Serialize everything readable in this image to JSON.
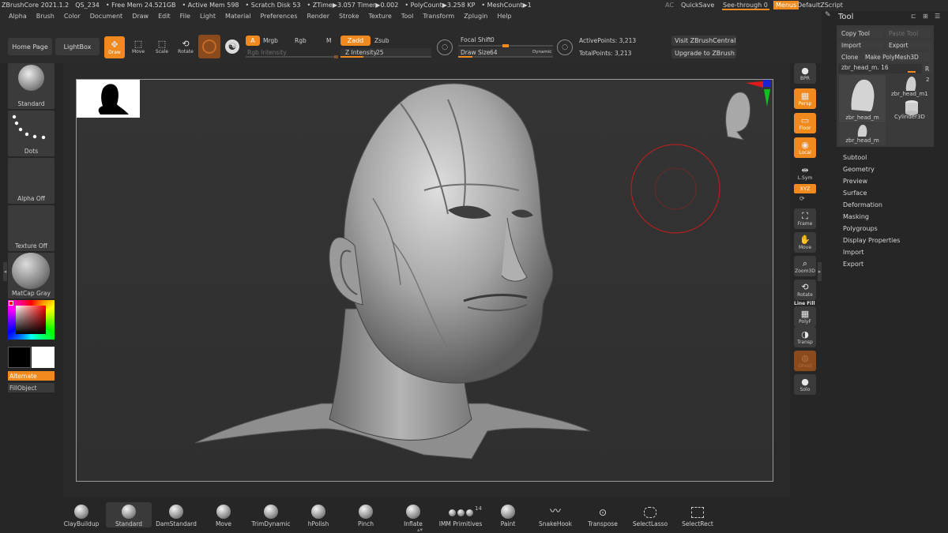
{
  "info": {
    "app": "ZBrushCore 2021.1.2",
    "file": "QS_234",
    "free_mem": "• Free Mem 24.521GB",
    "active_mem": "• Active Mem 598",
    "scratch": "• Scratch Disk 53",
    "ztime": "• ZTime▶3.057 Timer▶0.002",
    "polycount": "• PolyCount▶3.258 KP",
    "meshcount": "• MeshCount▶1"
  },
  "menus": [
    "Alpha",
    "Brush",
    "Color",
    "Document",
    "Draw",
    "Edit",
    "File",
    "Light",
    "Material",
    "Preferences",
    "Render",
    "Stroke",
    "Texture",
    "Tool",
    "Transform",
    "Zplugin",
    "Help"
  ],
  "topright": {
    "ac": "AC",
    "quicksave": "QuickSave",
    "seethrough": "See-through  0",
    "menus": "Menus",
    "script": "DefaultZScript"
  },
  "toolbar": {
    "home": "Home Page",
    "lightbox": "LightBox",
    "draw": "Draw",
    "move": "Move",
    "scale": "Scale",
    "rotate": "Rotate",
    "a": "A",
    "mrgb": "Mrgb",
    "rgb": "Rgb",
    "m": "M",
    "zadd": "Zadd",
    "zsub": "Zsub",
    "rgb_intensity": "Rgb Intensity",
    "z_intensity_label": "Z Intensity",
    "z_intensity_value": "25",
    "z_intensity_fraction": 0.25,
    "focal_shift_label": "Focal Shift",
    "focal_shift_value": "0",
    "draw_size_label": "Draw Size",
    "draw_size_value": "64",
    "dynamic": "Dynamic",
    "active_points": "ActivePoints: 3,213",
    "total_points": "TotalPoints: 3,213",
    "visit": "Visit ZBrushCentral",
    "upgrade": "Upgrade to ZBrush"
  },
  "leftshelf": {
    "brush": "Standard",
    "stroke": "Dots",
    "alpha": "Alpha Off",
    "texture": "Texture Off",
    "material": "MatCap Gray",
    "alternate": "Alternate",
    "fillobject": "FillObject"
  },
  "rightshelf": [
    "BPR",
    "Persp",
    "Floor",
    "Local",
    "L.Sym",
    "XYZ",
    "Frame",
    "Move",
    "Zoom3D",
    "Rotate",
    "PolyF",
    "Transp",
    "Ghost",
    "Solo"
  ],
  "rightshelf_extra": {
    "linefill": "Line Fill"
  },
  "tool": {
    "title": "Tool",
    "copy": "Copy Tool",
    "paste": "Paste Tool",
    "import": "Import",
    "export": "Export",
    "clone": "Clone",
    "make_polymesh": "Make PolyMesh3D",
    "current": "zbr_head_m. 16",
    "r": "R",
    "thumbs": [
      "zbr_head_m",
      "zbr_head_m1",
      "Cylinder3D",
      "zbr_head_m"
    ],
    "count": "2",
    "subpalettes": [
      "Subtool",
      "Geometry",
      "Preview",
      "Surface",
      "Deformation",
      "Masking",
      "Polygroups",
      "Display Properties",
      "Import",
      "Export"
    ]
  },
  "bottom_brushes": [
    "ClayBuildup",
    "Standard",
    "DamStandard",
    "Move",
    "TrimDynamic",
    "hPolish",
    "Pinch",
    "Inflate",
    "IMM Primitives",
    "Paint",
    "SnakeHook",
    "Transpose",
    "SelectLasso",
    "SelectRect"
  ],
  "imm_count": "14",
  "colors": {
    "accent": "#f08a1e",
    "bg": "#262626"
  }
}
